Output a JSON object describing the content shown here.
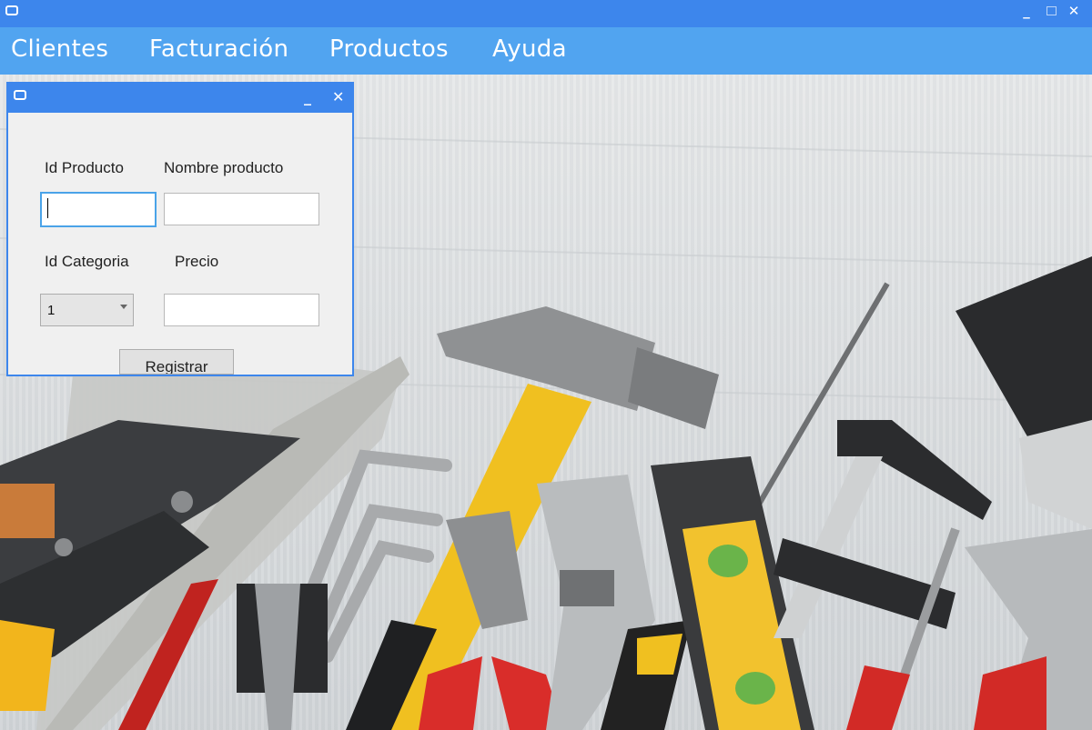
{
  "menu": {
    "items": [
      {
        "label": "Clientes"
      },
      {
        "label": "Facturación"
      },
      {
        "label": "Productos"
      },
      {
        "label": "Ayuda"
      }
    ]
  },
  "dialog": {
    "labels": {
      "id_producto": "Id Producto",
      "nombre_producto": "Nombre producto",
      "id_categoria": "Id Categoria",
      "precio": "Precio"
    },
    "fields": {
      "id_producto_value": "",
      "nombre_producto_value": "",
      "precio_value": ""
    },
    "categoria_selected": "1",
    "submit_label": "Registrar"
  },
  "colors": {
    "titlebar": "#3d86ec",
    "menubar": "#51a4f0",
    "menu_text": "#ffffff",
    "dialog_bg": "#f0f0f0",
    "focus_border": "#4aa3e8"
  },
  "icons": [
    "app-window-icon",
    "minimize-icon",
    "maximize-icon",
    "close-icon",
    "dropdown-arrow-icon"
  ]
}
